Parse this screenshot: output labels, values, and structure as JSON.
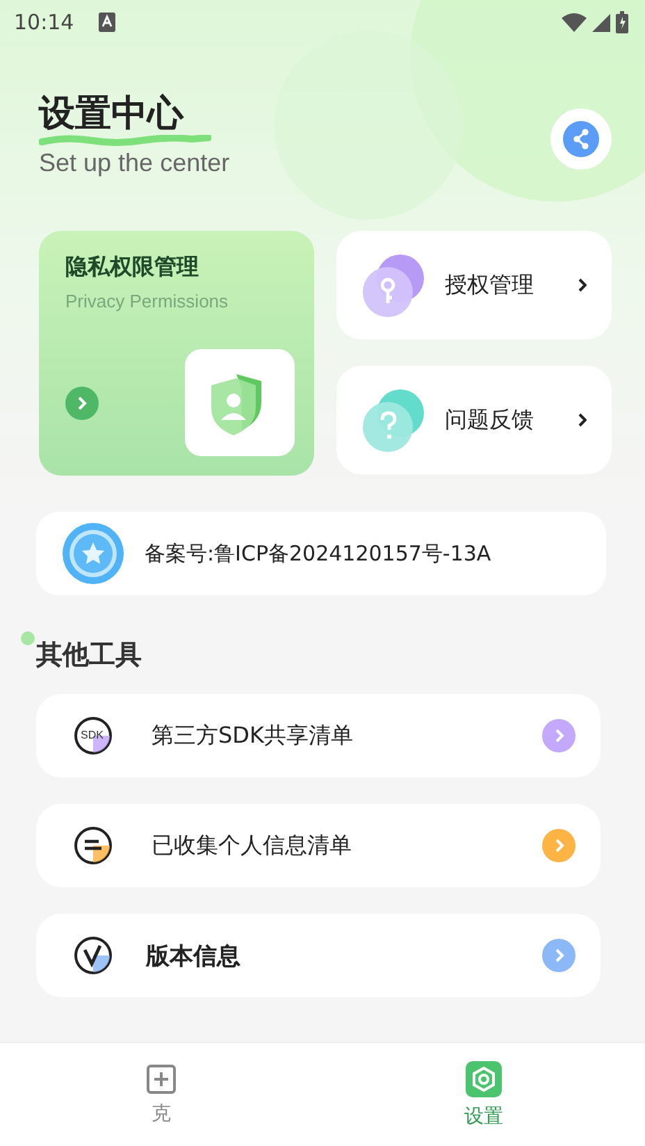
{
  "status_bar": {
    "time": "10:14"
  },
  "header": {
    "title": "设置中心",
    "subtitle": "Set up the center"
  },
  "privacy_card": {
    "title": "隐私权限管理",
    "subtitle": "Privacy Permissions"
  },
  "quick_cards": [
    {
      "kind": "key",
      "label": "授权管理"
    },
    {
      "kind": "question",
      "label": "问题反馈"
    }
  ],
  "record": {
    "text": "备案号:鲁ICP备2024120157号-13A"
  },
  "tools": {
    "title": "其他工具",
    "items": [
      {
        "kind": "sdk",
        "badge": "SDK",
        "label": "第三方SDK共享清单",
        "color": "#c4a8fb"
      },
      {
        "kind": "list",
        "label": "已收集个人信息清单",
        "color": "#fdb445"
      },
      {
        "kind": "version",
        "label": "版本信息",
        "color": "#8db8f8"
      }
    ]
  },
  "tabs": [
    {
      "kind": "add",
      "label": "克",
      "selected": false
    },
    {
      "kind": "settings",
      "label": "设置",
      "selected": true
    }
  ]
}
